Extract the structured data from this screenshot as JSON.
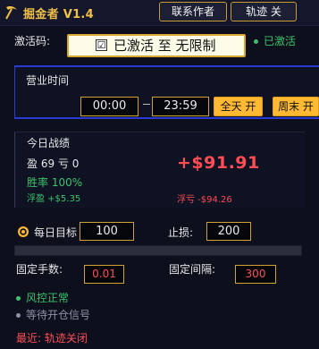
{
  "header": {
    "title": "掘金者 V1.4",
    "contact_button": "联系作者",
    "track_button": "轨迹 关"
  },
  "activation": {
    "label": "激活码:",
    "checkbox_mark": "☑",
    "value": "已激活 至 无限制",
    "status": "已激活"
  },
  "hours": {
    "title": "营业时间",
    "start": "00:00",
    "end": "23:59",
    "all_day_button": "全天 开",
    "weekend_button": "周末 开"
  },
  "stats": {
    "title": "今日战绩",
    "win_loss": "盈 69  亏 0",
    "win_rate": "胜率 100%",
    "floating_profit": "浮盈 +$5.35",
    "pnl": "+$91.91",
    "floating_loss": "浮亏 -$94.26"
  },
  "goal": {
    "label": "每日目标",
    "value": "100",
    "stop_loss_label": "止损:",
    "stop_loss_value": "200",
    "progress_fraction": 0
  },
  "fixed": {
    "lots_label": "固定手数:",
    "lots_value": "0.01",
    "interval_label": "固定间隔:",
    "interval_value": "300"
  },
  "status": {
    "risk": "风控正常",
    "waiting": "等待开仓信号",
    "recent": "最近: 轨迹关闭"
  },
  "colors": {
    "accent": "#ffb932",
    "profit": "#3ac46b",
    "loss": "#ff4d56",
    "panel_border": "#2a3ad4"
  }
}
